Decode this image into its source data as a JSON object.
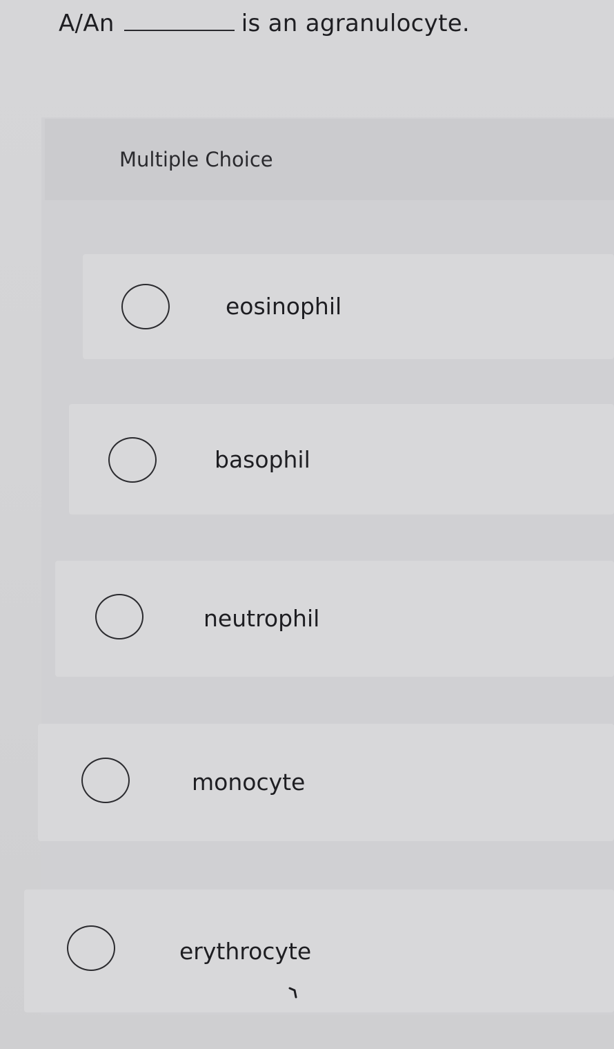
{
  "question": {
    "prefix": "A/An",
    "suffix": "is an agranulocyte."
  },
  "multiple_choice": {
    "title": "Multiple Choice",
    "options": [
      {
        "label": "eosinophil",
        "selected": false
      },
      {
        "label": "basophil",
        "selected": false
      },
      {
        "label": "neutrophil",
        "selected": false
      },
      {
        "label": "monocyte",
        "selected": false
      },
      {
        "label": "erythrocyte",
        "selected": false
      }
    ]
  },
  "icons": {
    "radio": "radio-unchecked-icon",
    "cursor": "mouse-cursor-icon"
  }
}
